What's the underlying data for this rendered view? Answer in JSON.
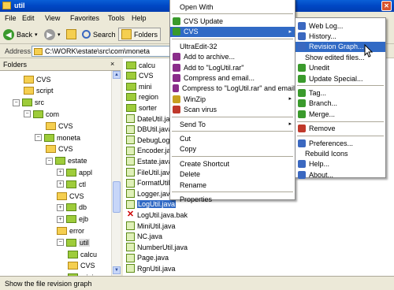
{
  "window": {
    "title": "util"
  },
  "menubar": [
    "File",
    "Edit",
    "View",
    "Favorites",
    "Tools",
    "Help"
  ],
  "toolbar": {
    "back": "Back",
    "search": "Search",
    "folders": "Folders"
  },
  "address": {
    "label": "Address",
    "path": "C:\\WORK\\estate\\src\\com\\moneta"
  },
  "folders_panel": {
    "title": "Folders",
    "close_glyph": "×",
    "tree": [
      {
        "label": "CVS",
        "type": "cvs"
      },
      {
        "label": "script",
        "type": "cvs"
      },
      {
        "label": "src",
        "type": "open",
        "exp": "−"
      },
      {
        "label": "com",
        "type": "open",
        "exp": "−"
      },
      {
        "label": "CVS",
        "type": "cvs"
      },
      {
        "label": "moneta",
        "type": "open",
        "exp": "−"
      },
      {
        "label": "CVS",
        "type": "cvs"
      },
      {
        "label": "estate",
        "type": "open",
        "exp": "−"
      },
      {
        "label": "appl",
        "type": "open",
        "exp": "+"
      },
      {
        "label": "ctl",
        "type": "open",
        "exp": "+"
      },
      {
        "label": "CVS",
        "type": "cvs"
      },
      {
        "label": "db",
        "type": "open",
        "exp": "+"
      },
      {
        "label": "ejb",
        "type": "open",
        "exp": "+"
      },
      {
        "label": "error",
        "type": "cvs"
      },
      {
        "label": "util",
        "type": "open",
        "exp": "−",
        "selected": true
      },
      {
        "label": "calcu",
        "type": "open"
      },
      {
        "label": "CVS",
        "type": "cvs"
      },
      {
        "label": "mini",
        "type": "open"
      },
      {
        "label": "region",
        "type": "open"
      }
    ]
  },
  "files": [
    {
      "name": "calcu",
      "kind": "folder"
    },
    {
      "name": "CVS",
      "kind": "folder"
    },
    {
      "name": "mini",
      "kind": "folder"
    },
    {
      "name": "region",
      "kind": "folder"
    },
    {
      "name": "sorter",
      "kind": "folder"
    },
    {
      "name": "DateUtil.java",
      "kind": "file"
    },
    {
      "name": "DBUtil.java",
      "kind": "file"
    },
    {
      "name": "DebugLog.j",
      "kind": "file"
    },
    {
      "name": "Encoder.java",
      "kind": "file"
    },
    {
      "name": "Estate.java",
      "kind": "file"
    },
    {
      "name": "FileUtil.java",
      "kind": "file"
    },
    {
      "name": "FormatUtil.j",
      "kind": "file"
    },
    {
      "name": "Logger.java",
      "kind": "file"
    },
    {
      "name": "LogUtil.java",
      "kind": "file",
      "selected": true
    },
    {
      "name": "LogUtil.java.bak",
      "kind": "bad"
    },
    {
      "name": "MiniUtil.java",
      "kind": "file"
    },
    {
      "name": "NC.java",
      "kind": "file"
    },
    {
      "name": "NumberUtil.java",
      "kind": "file"
    },
    {
      "name": "Page.java",
      "kind": "file"
    },
    {
      "name": "RgnUtil.java",
      "kind": "file"
    }
  ],
  "context_menu": {
    "items": [
      {
        "label": "Open With",
        "icon": ""
      },
      {
        "sep": true
      },
      {
        "label": "CVS Update",
        "icon": "cvs-update-icon"
      },
      {
        "label": "CVS",
        "icon": "cvs-icon",
        "highlight": true,
        "submenu": "▸"
      },
      {
        "sep": true
      },
      {
        "label": "UltraEdit-32",
        "icon": ""
      },
      {
        "label": "Add to archive...",
        "icon": "winrar-icon"
      },
      {
        "label": "Add to \"LogUtil.rar\"",
        "icon": "winrar-icon"
      },
      {
        "label": "Compress and email...",
        "icon": "winrar-icon"
      },
      {
        "label": "Compress to \"LogUtil.rar\" and email",
        "icon": "winrar-icon"
      },
      {
        "label": "WinZip",
        "icon": "winzip-icon",
        "submenu": "▸"
      },
      {
        "label": "Scan virus",
        "icon": "virus-scan-icon"
      },
      {
        "sep": true
      },
      {
        "label": "Send To",
        "icon": "",
        "submenu": "▸"
      },
      {
        "sep": true
      },
      {
        "label": "Cut",
        "icon": ""
      },
      {
        "label": "Copy",
        "icon": ""
      },
      {
        "sep": true
      },
      {
        "label": "Create Shortcut",
        "icon": ""
      },
      {
        "label": "Delete",
        "icon": ""
      },
      {
        "label": "Rename",
        "icon": ""
      },
      {
        "sep": true
      },
      {
        "label": "Properties",
        "icon": ""
      }
    ]
  },
  "cvs_submenu": {
    "items": [
      {
        "label": "Web Log...",
        "icon": "web-log-icon"
      },
      {
        "label": "History...",
        "icon": "history-icon"
      },
      {
        "label": "Revision Graph...",
        "icon": "revision-graph-icon",
        "highlight": true
      },
      {
        "label": "Show edited files...",
        "icon": ""
      },
      {
        "label": "Unedit",
        "icon": "unedit-icon"
      },
      {
        "label": "Update Special...",
        "icon": "update-special-icon"
      },
      {
        "sep": true
      },
      {
        "label": "Tag...",
        "icon": "tag-icon"
      },
      {
        "label": "Branch...",
        "icon": "branch-icon"
      },
      {
        "label": "Merge...",
        "icon": "merge-icon"
      },
      {
        "sep": true
      },
      {
        "label": "Remove",
        "icon": "remove-icon"
      },
      {
        "sep": true
      },
      {
        "label": "Preferences...",
        "icon": "preferences-icon"
      },
      {
        "label": "Rebuild Icons",
        "icon": ""
      },
      {
        "label": "Help...",
        "icon": "help-icon"
      },
      {
        "label": "About...",
        "icon": "about-icon"
      }
    ]
  },
  "statusbar": {
    "text": "Show the file revision graph"
  },
  "colors": {
    "title_blue": "#0a5fd6",
    "highlight": "#316ac5",
    "window_bg": "#ece9d8"
  }
}
